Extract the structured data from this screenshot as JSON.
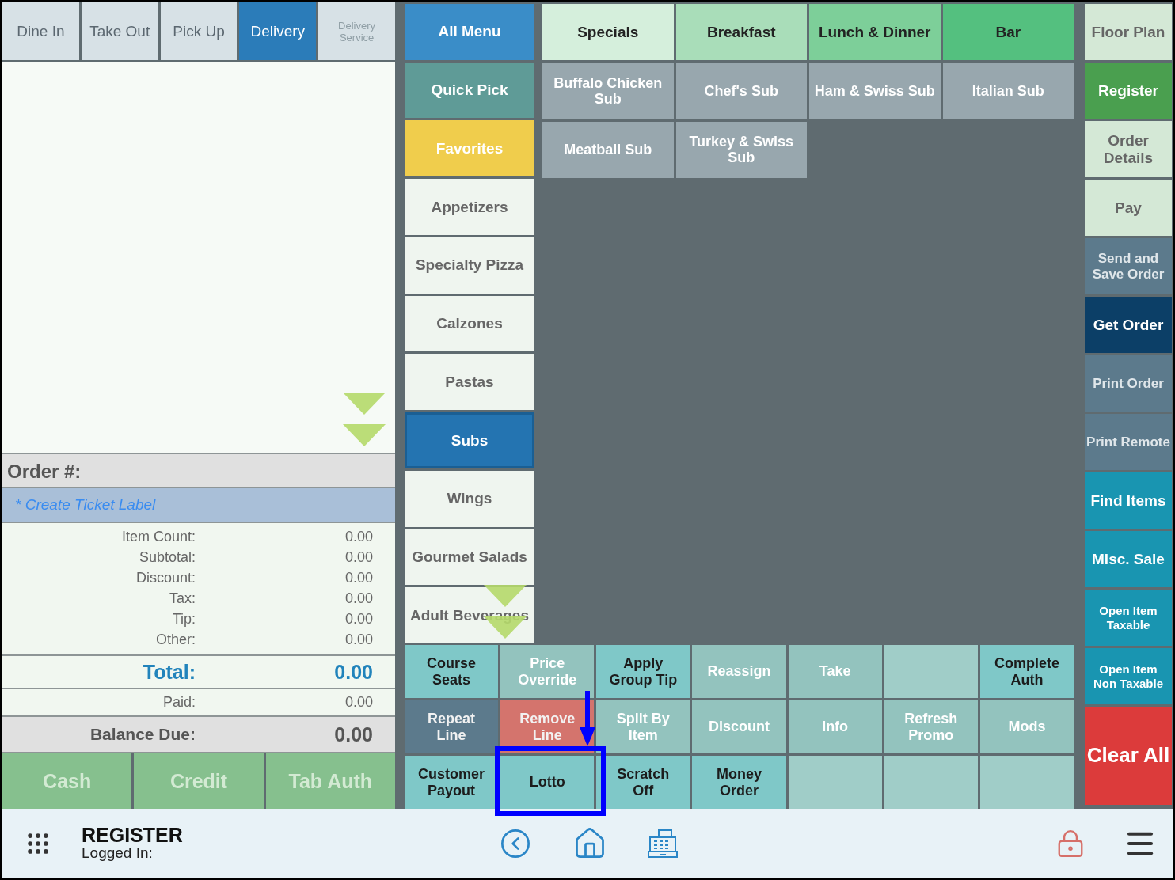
{
  "order_types": [
    {
      "label": "Dine In",
      "selected": false,
      "disabled": false
    },
    {
      "label": "Take Out",
      "selected": false,
      "disabled": false
    },
    {
      "label": "Pick Up",
      "selected": false,
      "disabled": false
    },
    {
      "label": "Delivery",
      "selected": true,
      "disabled": false
    },
    {
      "label": "Delivery Service",
      "selected": false,
      "disabled": true
    }
  ],
  "order": {
    "number_label": "Order #:",
    "ticket_label": "* Create Ticket Label",
    "summary": [
      {
        "label": "Item Count:",
        "value": "0.00"
      },
      {
        "label": "Subtotal:",
        "value": "0.00"
      },
      {
        "label": "Discount:",
        "value": "0.00"
      },
      {
        "label": "Tax:",
        "value": "0.00"
      },
      {
        "label": "Tip:",
        "value": "0.00"
      },
      {
        "label": "Other:",
        "value": "0.00"
      }
    ],
    "total": {
      "label": "Total:",
      "value": "0.00"
    },
    "paid": {
      "label": "Paid:",
      "value": "0.00"
    },
    "balance": {
      "label": "Balance Due:",
      "value": "0.00"
    }
  },
  "payment_buttons": [
    {
      "label": "Cash",
      "disabled": true
    },
    {
      "label": "Credit",
      "disabled": true
    },
    {
      "label": "Tab Auth",
      "disabled": true
    }
  ],
  "categories": [
    {
      "label": "All Menu",
      "kind": "all",
      "selected": false
    },
    {
      "label": "Quick Pick",
      "kind": "quick",
      "selected": false
    },
    {
      "label": "Favorites",
      "kind": "favorites",
      "selected": false
    },
    {
      "label": "Appetizers",
      "kind": "category",
      "selected": false
    },
    {
      "label": "Specialty Pizza",
      "kind": "category",
      "selected": false
    },
    {
      "label": "Calzones",
      "kind": "category",
      "selected": false
    },
    {
      "label": "Pastas",
      "kind": "category",
      "selected": false
    },
    {
      "label": "Subs",
      "kind": "category",
      "selected": true
    },
    {
      "label": "Wings",
      "kind": "category",
      "selected": false
    },
    {
      "label": "Gourmet Salads",
      "kind": "category",
      "selected": false
    },
    {
      "label": "Adult Beverages",
      "kind": "category",
      "selected": false
    }
  ],
  "menu_groups": [
    {
      "label": "Specials",
      "color": "#d5efdc"
    },
    {
      "label": "Breakfast",
      "color": "#a9ddb9"
    },
    {
      "label": "Lunch & Dinner",
      "color": "#7dcf99"
    },
    {
      "label": "Bar",
      "color": "#54c07f"
    }
  ],
  "items": [
    "Buffalo Chicken Sub",
    "Chef's Sub",
    "Ham & Swiss Sub",
    "Italian Sub",
    "Meatball Sub",
    "Turkey & Swiss Sub"
  ],
  "actions": [
    {
      "label": "Course Seats",
      "kind": "teal",
      "disabled": false
    },
    {
      "label": "Price Override",
      "kind": "teal",
      "disabled": true
    },
    {
      "label": "Apply Group Tip",
      "kind": "teal",
      "disabled": false
    },
    {
      "label": "Reassign",
      "kind": "teal",
      "disabled": true
    },
    {
      "label": "Take",
      "kind": "teal",
      "disabled": true
    },
    {
      "kind": "empty"
    },
    {
      "label": "Complete Auth",
      "kind": "teal",
      "disabled": false
    },
    {
      "label": "Repeat Line",
      "kind": "slate",
      "disabled": false
    },
    {
      "label": "Remove Line",
      "kind": "red",
      "disabled": false
    },
    {
      "label": "Split By Item",
      "kind": "teal",
      "disabled": true
    },
    {
      "label": "Discount",
      "kind": "teal",
      "disabled": true
    },
    {
      "label": "Info",
      "kind": "teal",
      "disabled": true
    },
    {
      "label": "Refresh Promo",
      "kind": "teal",
      "disabled": true
    },
    {
      "label": "Mods",
      "kind": "teal",
      "disabled": true
    },
    {
      "label": "Customer Payout",
      "kind": "teal",
      "disabled": false
    },
    {
      "label": "Lotto",
      "kind": "teal",
      "disabled": false
    },
    {
      "label": "Scratch Off",
      "kind": "teal",
      "disabled": false
    },
    {
      "label": "Money Order",
      "kind": "teal",
      "disabled": false
    },
    {
      "kind": "empty"
    },
    {
      "kind": "empty"
    },
    {
      "kind": "empty"
    }
  ],
  "side_buttons": [
    {
      "label": "Floor Plan",
      "kind": "light"
    },
    {
      "label": "Register",
      "kind": "green"
    },
    {
      "label": "Order Details",
      "kind": "light"
    },
    {
      "label": "Pay",
      "kind": "light"
    },
    {
      "label": "Send and Save Order",
      "kind": "slate"
    },
    {
      "label": "Get Order",
      "kind": "navy"
    },
    {
      "label": "Print Order",
      "kind": "slate"
    },
    {
      "label": "Print Remote",
      "kind": "slate"
    },
    {
      "label": "Find Items",
      "kind": "cyan"
    },
    {
      "label": "Misc. Sale",
      "kind": "cyan"
    },
    {
      "label": "Open Item Taxable",
      "kind": "cyan_small"
    },
    {
      "label": "Open Item Non Taxable",
      "kind": "cyan_small"
    },
    {
      "label": "Clear All",
      "kind": "red"
    }
  ],
  "status_bar": {
    "title": "REGISTER",
    "subtitle": "Logged In:"
  }
}
